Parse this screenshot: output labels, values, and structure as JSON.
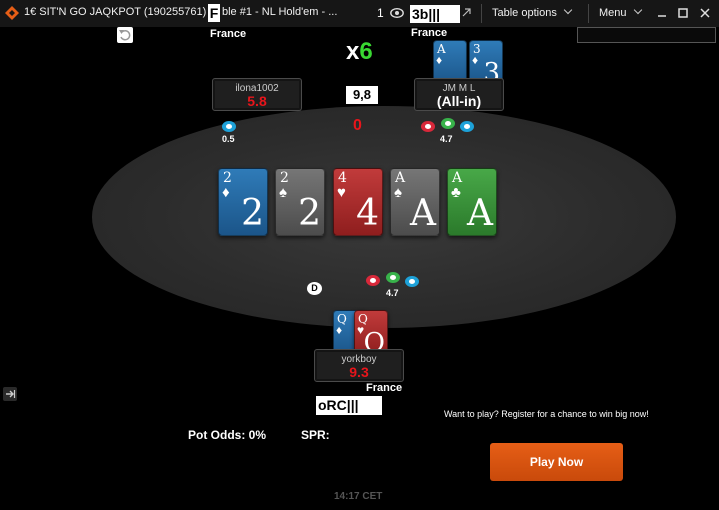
{
  "titlebar": {
    "title": "1€ SIT'N GO JAQKPOT (190255761)",
    "title_overlay": "F",
    "table_name": "ble #1 -  NL  Hold'em -  ...",
    "observers": "1",
    "overlay": "3b|||",
    "table_options": "Table options",
    "menu": "Menu"
  },
  "players": {
    "left": {
      "name": "ilona1002",
      "stack": "5.8",
      "bet": "0.5"
    },
    "right": {
      "name": "JM M L",
      "stack": "(All-in)",
      "bet": "4.7",
      "country": "France"
    },
    "hero": {
      "name": "yorkboy",
      "stack": "9.3",
      "bet": "4.7",
      "country": "France",
      "overlay": "oRC|||"
    }
  },
  "top_left_country": "France",
  "multiplier": {
    "x": "x",
    "value": "6"
  },
  "pot": {
    "box": "9,8",
    "zero": "0"
  },
  "dealer": "D",
  "board": [
    {
      "rank": "2",
      "suit": "♦",
      "color": "blue"
    },
    {
      "rank": "2",
      "suit": "♠",
      "color": "gray"
    },
    {
      "rank": "4",
      "suit": "♥",
      "color": "red"
    },
    {
      "rank": "A",
      "suit": "♠",
      "color": "gray"
    },
    {
      "rank": "A",
      "suit": "♣",
      "color": "green"
    }
  ],
  "right_cards": [
    {
      "rank": "A",
      "suit": "♦",
      "color": "blue"
    },
    {
      "rank": "3",
      "suit": "♦",
      "color": "blue"
    }
  ],
  "hero_cards": [
    {
      "rank": "Q",
      "suit": "♦",
      "color": "blue"
    },
    {
      "rank": "Q",
      "suit": "♥",
      "color": "red"
    }
  ],
  "promo": "Want to play? Register for a chance to win big now!",
  "play_now": "Play Now",
  "stats": {
    "pot_odds": "Pot Odds: 0%",
    "spr": "SPR:"
  },
  "clock": "14:17 CET",
  "colors": {
    "stack_red": "#e8151b",
    "play_orange": "#e65e16",
    "multiplier_green": "#39d832"
  }
}
